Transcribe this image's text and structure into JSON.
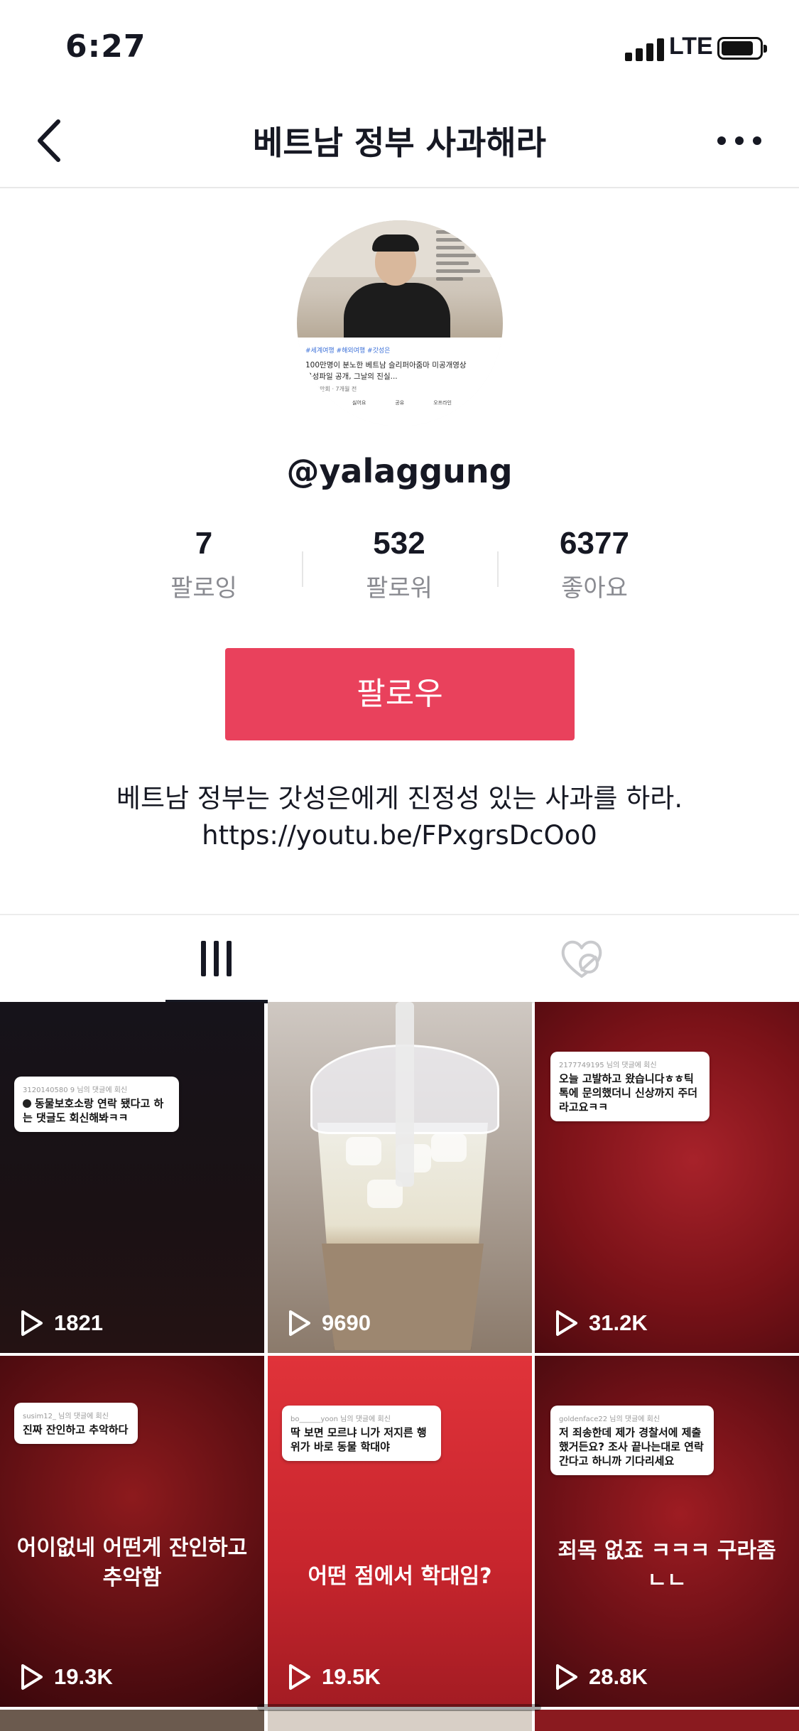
{
  "status_bar": {
    "time": "6:27",
    "network": "LTE"
  },
  "nav": {
    "title": "베트남 정부 사과해라"
  },
  "profile": {
    "avatar_caption": {
      "tags": "#세계여행 #해외여행 #갓성은",
      "line1": "100만명이 분노한 베트남 슬리퍼아줌마 미공개영상",
      "line2": "음성파일 공개, 그날의 진실...",
      "meta": "14만회 · 7개월 전",
      "actions": [
        "싫어요",
        "공유",
        "오프라인"
      ]
    },
    "username": "@yalaggung",
    "stats": {
      "following": {
        "value": "7",
        "label": "팔로잉"
      },
      "followers": {
        "value": "532",
        "label": "팔로워"
      },
      "likes": {
        "value": "6377",
        "label": "좋아요"
      }
    },
    "follow_label": "팔로우",
    "bio_line1": "베트남 정부는 갓성은에게 진정성 있는 사과를 하라.",
    "bio_line2": "https://youtu.be/FPxgrsDcOo0"
  },
  "tabs": [
    {
      "icon": "grid-icon",
      "selected": true
    },
    {
      "icon": "liked-heart-hidden-icon",
      "selected": false
    }
  ],
  "videos": [
    {
      "views": "1821",
      "reply_sub": "3120140580 9 님의 댓글에 회신",
      "reply_text": "동물보호소랑 연락 됐다고 하는 댓글도 회신해봐ㅋㅋ",
      "overlay": ""
    },
    {
      "views": "9690",
      "reply_sub": "",
      "reply_text": "",
      "overlay": ""
    },
    {
      "views": "31.2K",
      "reply_sub": "2177749195 님의 댓글에 회신",
      "reply_text": "오늘 고발하고 왔습니다ㅎㅎ틱톡에 문의했더니 신상까지 주더라고요ㅋㅋ",
      "overlay": ""
    },
    {
      "views": "19.3K",
      "reply_sub": "susim12_ 님의 댓글에 회신",
      "reply_text": "진짜 잔인하고 추악하다",
      "overlay": "어이없네 어떤게 잔인하고 추악함"
    },
    {
      "views": "19.5K",
      "reply_sub": "bo______yoon 님의 댓글에 회신",
      "reply_text": "딱 보면 모르냐 니가 저지른 행위가 바로 동물 학대야",
      "overlay": "어떤 점에서 학대임?"
    },
    {
      "views": "28.8K",
      "reply_sub": "goldenface22 님의 댓글에 회신",
      "reply_text": "저 죄송한데 제가 경찰서에 제출했거든요? 조사 끝나는대로 연락 간다고 하니까 기다리세요",
      "overlay": "죄목 없죠 ㅋㅋㅋ 구라좀 ㄴㄴ"
    }
  ],
  "colors": {
    "accent": "#e9415c",
    "text": "#161823",
    "muted": "#8a8b91"
  }
}
